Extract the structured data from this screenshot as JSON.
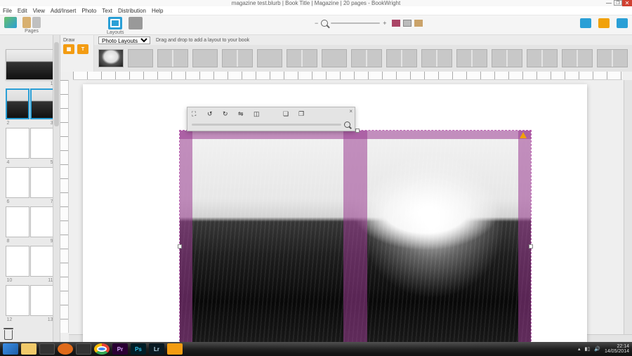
{
  "window": {
    "title": "magazine test.blurb | Book Title | Magazine | 20 pages - BookWright"
  },
  "menu": {
    "items": [
      "File",
      "Edit",
      "View",
      "Add/Insert",
      "Photo",
      "Text",
      "Distribution",
      "Help"
    ]
  },
  "toolbar": {
    "pages_label": "Pages",
    "layouts_label": "Layouts"
  },
  "layout_strip": {
    "draw_label": "Draw",
    "dropdown_value": "Photo Layouts",
    "hint": "Drag and drop to add a layout to your book"
  },
  "sidebar": {
    "thumbs": [
      {
        "kind": "cover",
        "num_left": "",
        "num_right": "1"
      },
      {
        "kind": "spread",
        "num_left": "2",
        "num_right": "3",
        "selected": true,
        "image": true
      },
      {
        "kind": "spread",
        "num_left": "4",
        "num_right": "5"
      },
      {
        "kind": "spread",
        "num_left": "6",
        "num_right": "7"
      },
      {
        "kind": "spread",
        "num_left": "8",
        "num_right": "9"
      },
      {
        "kind": "spread",
        "num_left": "10",
        "num_right": "11"
      },
      {
        "kind": "spread",
        "num_left": "12",
        "num_right": "13"
      }
    ]
  },
  "floatbar": {
    "icons": [
      "fit-icon",
      "rotate-left-icon",
      "rotate-right-icon",
      "flip-icon",
      "crop-icon",
      "send-back-icon",
      "bring-front-icon"
    ]
  },
  "tray": {
    "time": "22:14",
    "date": "14/05/2014"
  },
  "taskbar": {
    "pr": "Pr",
    "ps": "Ps",
    "lr": "Lr"
  }
}
